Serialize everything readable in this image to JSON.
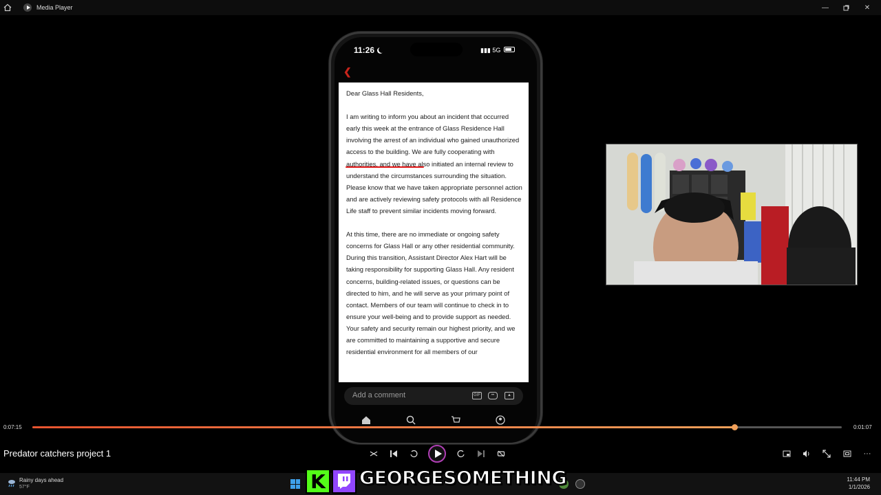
{
  "window": {
    "title": "Media Player",
    "controls": [
      "minimize",
      "maximize",
      "close"
    ]
  },
  "phone": {
    "status_time": "11:26",
    "network": "5G",
    "letter": {
      "salutation": "Dear Glass Hall Residents,",
      "paragraph_1": "I am writing to inform you about an incident that occurred early this week at the entrance of Glass Residence Hall involving the arrest of an individual who gained unauthorized access to the building. We are fully cooperating with authorities, and we have also initiated an internal review to understand the circumstances surrounding the situation. Please know that we have taken appropriate personnel action and are actively reviewing safety protocols with all Residence Life staff to prevent similar incidents moving forward.",
      "paragraph_2": "At this time, there are no immediate or ongoing safety concerns for Glass Hall or any other residential community. During this transition, Assistant Director Alex Hart will be taking responsibility for supporting Glass Hall. Any resident concerns, building-related issues, or questions can be directed to him, and he will serve as your primary point of contact. Members of our team will continue to check in to ensure your well-being and to provide support as needed.  Your safety and security remain our highest priority, and we are committed to maintaining a supportive and secure residential environment for all members of our"
    },
    "comment_placeholder": "Add a comment",
    "comment_icons": [
      "gif-icon",
      "sticker-icon",
      "image-icon"
    ],
    "nav_icons": [
      "home-icon",
      "search-icon",
      "cart-icon",
      "profile-icon"
    ]
  },
  "player": {
    "elapsed": "0:07:15",
    "remaining": "0:01:07",
    "progress": 0.867,
    "video_title": "Predator catchers project 1"
  },
  "taskbar": {
    "weather_title": "Rainy days ahead",
    "weather_temp": "57°F",
    "streamer_name": "GEORGESOMETHING",
    "kick_glyph": "K",
    "clock_time": "11:44 PM",
    "clock_date": "1/1/2026"
  },
  "colors": {
    "seek_fill": "#e8542f",
    "play_ring": "#b03fb5",
    "kick": "#53fc18",
    "twitch": "#9146ff",
    "underline": "#dd1111"
  }
}
